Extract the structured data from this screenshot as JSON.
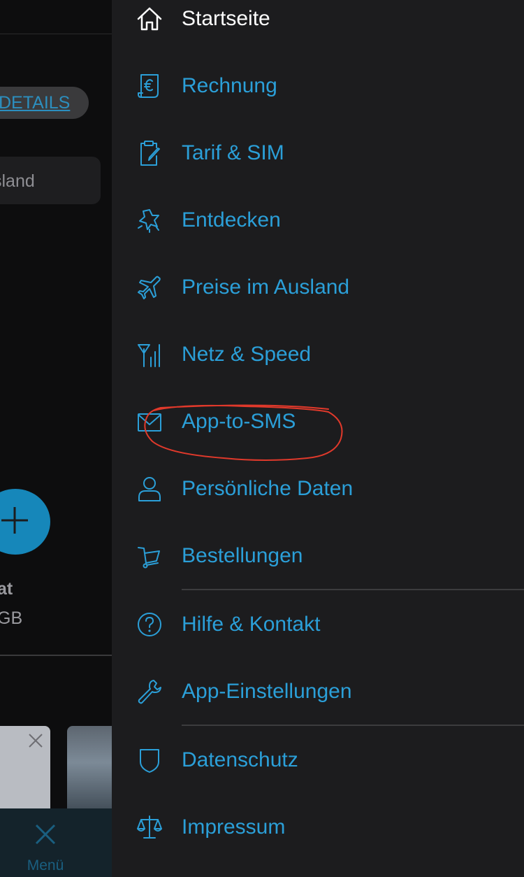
{
  "background_app": {
    "details_button": "DETAILS",
    "ausland_text": "sland",
    "label_partial_1": "at",
    "label_partial_2": "GB",
    "tabbar_menu_label": "Menü"
  },
  "menu": {
    "items": [
      {
        "label": "Startseite",
        "icon": "home-icon"
      },
      {
        "label": "Rechnung",
        "icon": "invoice-euro-icon"
      },
      {
        "label": "Tarif & SIM",
        "icon": "clipboard-edit-icon"
      },
      {
        "label": "Entdecken",
        "icon": "star-badge-icon"
      },
      {
        "label": "Preise im Ausland",
        "icon": "airplane-icon"
      },
      {
        "label": "Netz & Speed",
        "icon": "antenna-icon"
      },
      {
        "label": "App-to-SMS",
        "icon": "envelope-icon"
      },
      {
        "label": "Persönliche Daten",
        "icon": "user-icon"
      },
      {
        "label": "Bestellungen",
        "icon": "cart-icon"
      },
      {
        "label": "Hilfe & Kontakt",
        "icon": "help-circle-icon"
      },
      {
        "label": "App-Einstellungen",
        "icon": "wrench-icon"
      },
      {
        "label": "Datenschutz",
        "icon": "shield-icon"
      },
      {
        "label": "Impressum",
        "icon": "scale-icon"
      }
    ]
  },
  "colors": {
    "accent": "#2b9fd8",
    "drawer_bg": "#1c1c1e",
    "annotation": "#e0392b"
  }
}
